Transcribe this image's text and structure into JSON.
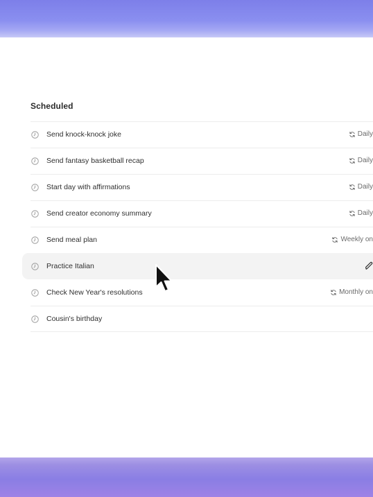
{
  "section_title": "Scheduled",
  "tasks": [
    {
      "label": "Send knock-knock joke",
      "frequency": "Daily",
      "icon": "clock-icon",
      "freq_icon": "repeat-icon"
    },
    {
      "label": "Send fantasy basketball recap",
      "frequency": "Daily",
      "icon": "clock-icon",
      "freq_icon": "repeat-icon"
    },
    {
      "label": "Start day with affirmations",
      "frequency": "Daily",
      "icon": "clock-icon",
      "freq_icon": "repeat-icon"
    },
    {
      "label": "Send creator economy summary",
      "frequency": "Daily",
      "icon": "clock-icon",
      "freq_icon": "repeat-icon"
    },
    {
      "label": "Send meal plan",
      "frequency": "Weekly on",
      "icon": "clock-icon",
      "freq_icon": "repeat-icon"
    },
    {
      "label": "Practice Italian",
      "frequency": "",
      "icon": "clock-icon",
      "action_icon": "edit-icon"
    },
    {
      "label": "Check New Year's resolutions",
      "frequency": "Monthly on",
      "icon": "clock-icon",
      "freq_icon": "repeat-icon"
    },
    {
      "label": "Cousin's birthday",
      "frequency": "",
      "icon": "clock-icon"
    }
  ],
  "colors": {
    "accent_top": "#7d7fe9",
    "accent_bottom": "#8a7ee4",
    "panel": "#ffffff",
    "row_hover": "#f3f3f3"
  }
}
